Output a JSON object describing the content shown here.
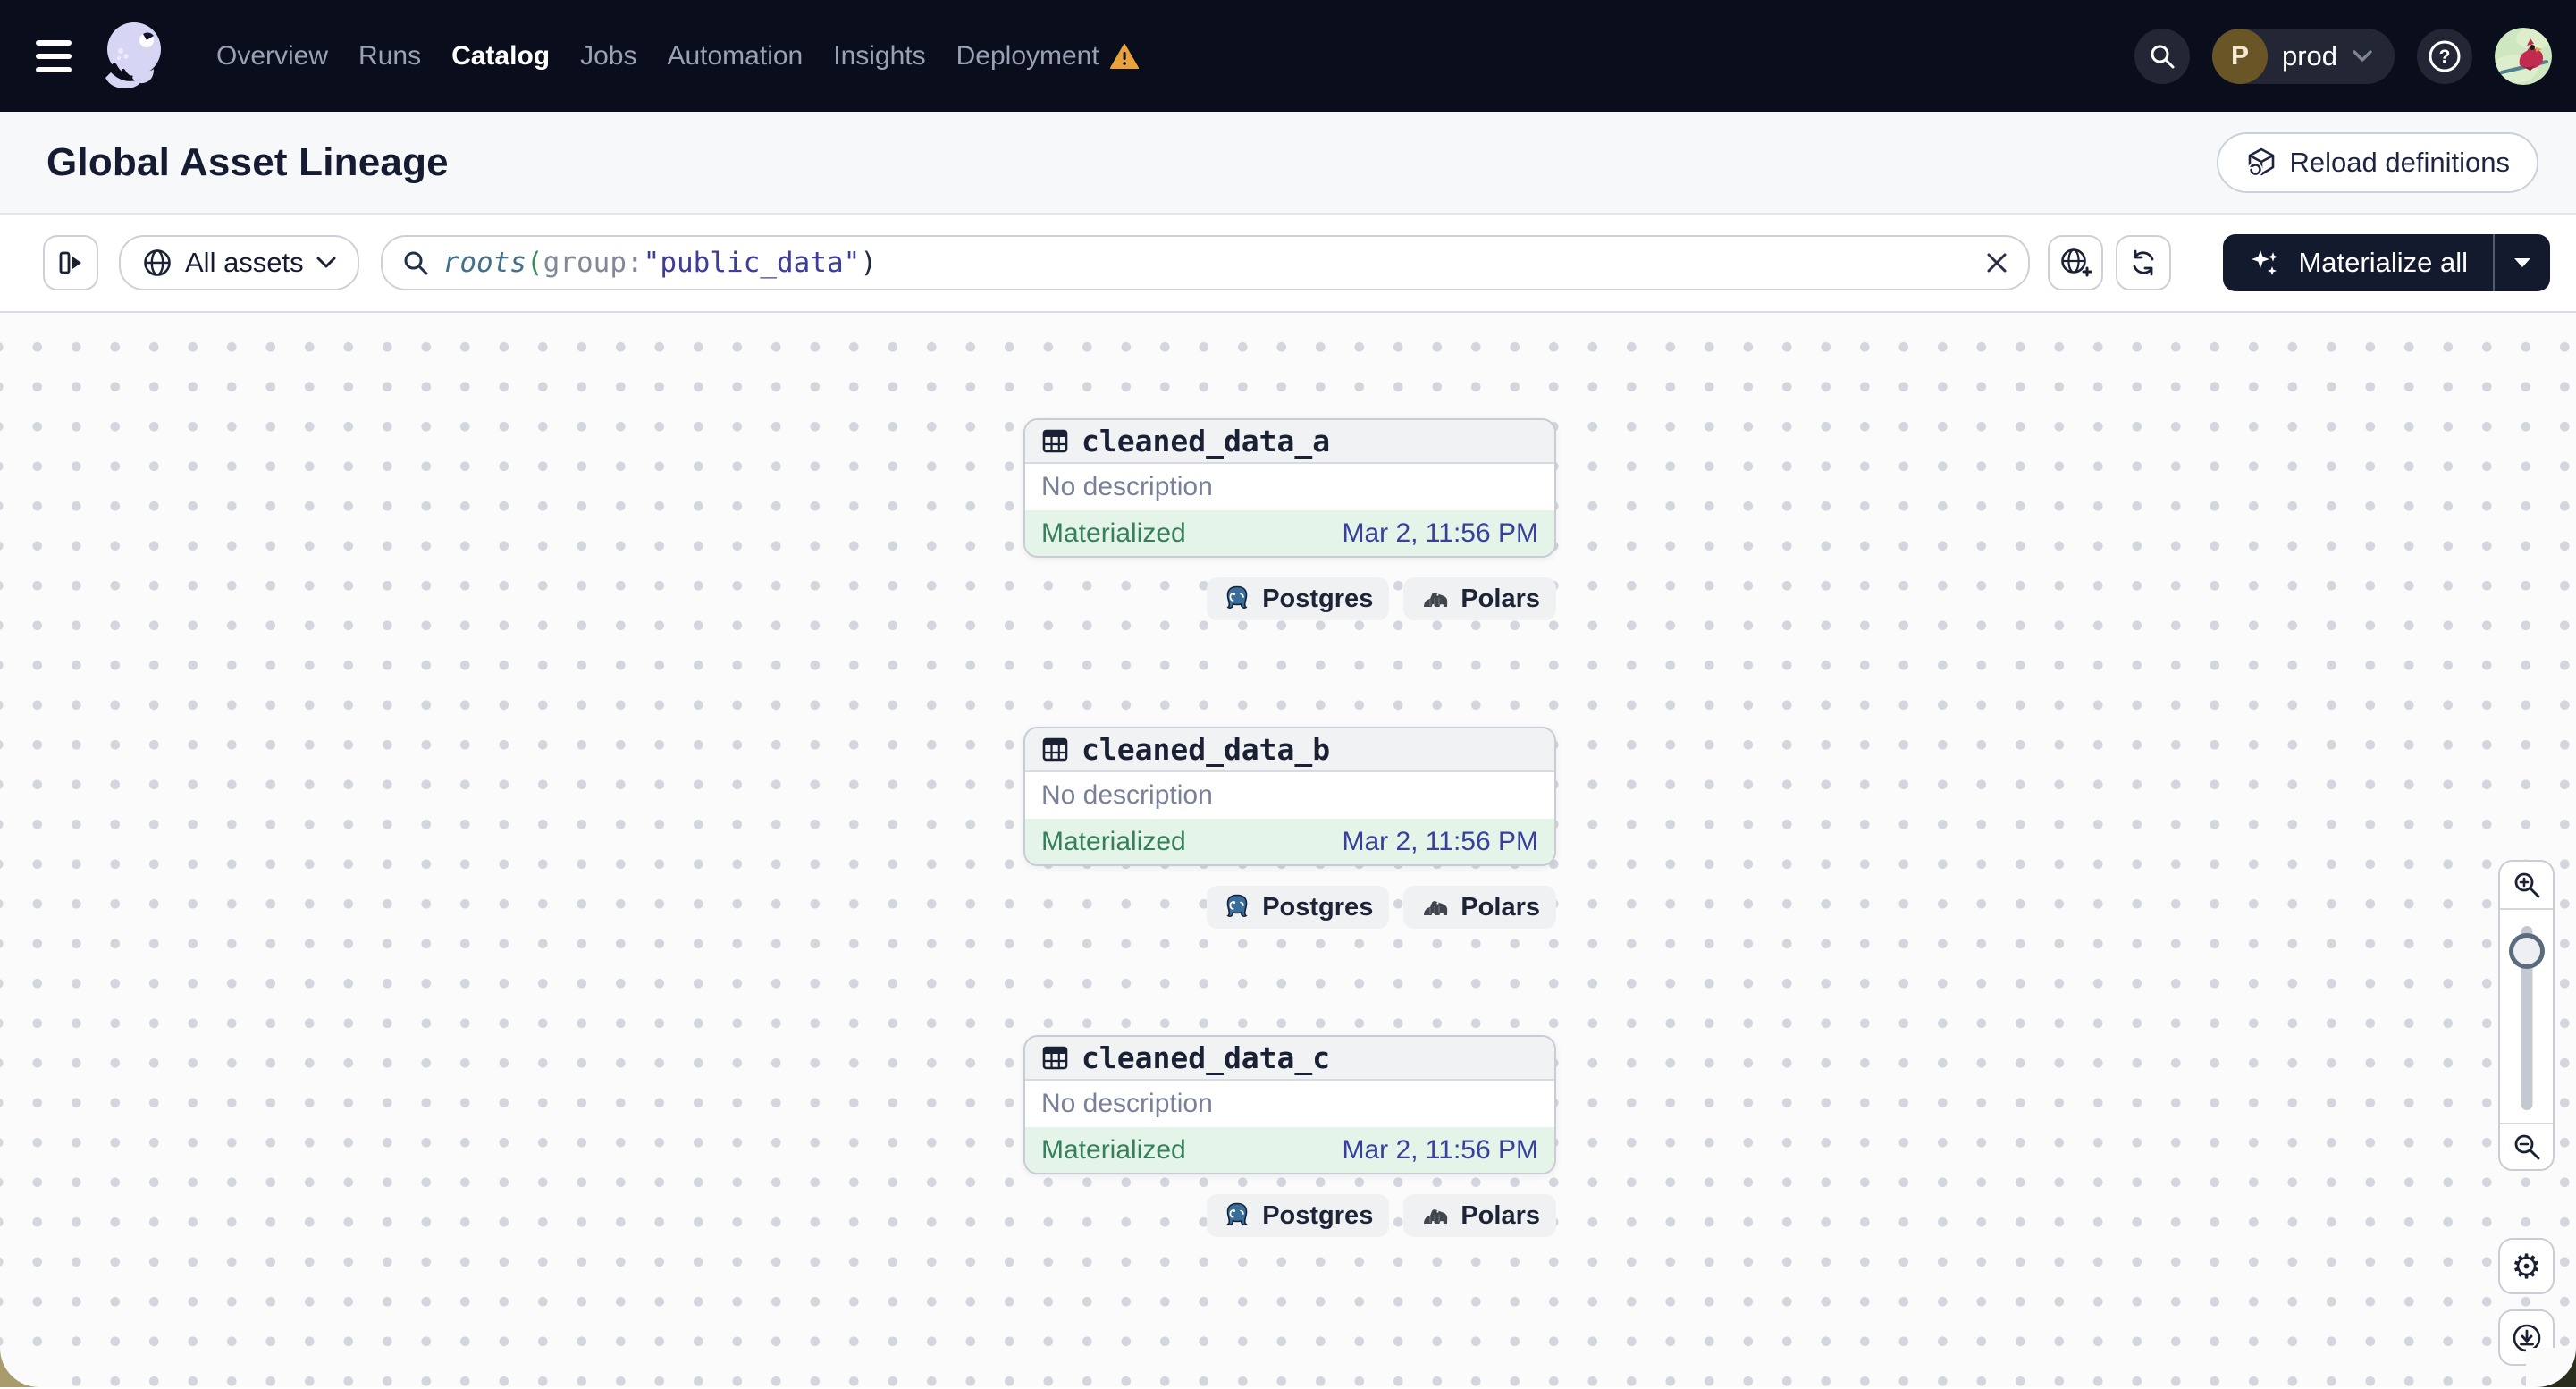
{
  "nav": {
    "items": [
      {
        "label": "Overview"
      },
      {
        "label": "Runs"
      },
      {
        "label": "Catalog",
        "active": true
      },
      {
        "label": "Jobs"
      },
      {
        "label": "Automation"
      },
      {
        "label": "Insights"
      },
      {
        "label": "Deployment",
        "warning": true
      }
    ],
    "environment": {
      "badge": "P",
      "name": "prod"
    }
  },
  "header": {
    "title": "Global Asset Lineage",
    "reload_label": "Reload definitions"
  },
  "toolbar": {
    "filter_label": "All assets",
    "query": {
      "fn": "roots",
      "open_paren": "(",
      "key": "group",
      "colon": ":",
      "value": "\"public_data\"",
      "close_paren": ")"
    },
    "materialize_label": "Materialize all"
  },
  "graph": {
    "nodes": [
      {
        "name": "cleaned_data_a",
        "description": "No description",
        "status": "Materialized",
        "timestamp": "Mar 2, 11:56 PM",
        "tags": [
          {
            "label": "Postgres",
            "icon": "postgres-icon"
          },
          {
            "label": "Polars",
            "icon": "polars-icon"
          }
        ]
      },
      {
        "name": "cleaned_data_b",
        "description": "No description",
        "status": "Materialized",
        "timestamp": "Mar 2, 11:56 PM",
        "tags": [
          {
            "label": "Postgres",
            "icon": "postgres-icon"
          },
          {
            "label": "Polars",
            "icon": "polars-icon"
          }
        ]
      },
      {
        "name": "cleaned_data_c",
        "description": "No description",
        "status": "Materialized",
        "timestamp": "Mar 2, 11:56 PM",
        "tags": [
          {
            "label": "Postgres",
            "icon": "postgres-icon"
          },
          {
            "label": "Polars",
            "icon": "polars-icon"
          }
        ]
      }
    ]
  },
  "colors": {
    "nav_bg": "#0a0d1b",
    "warning_orange": "#e9a13b",
    "status_green_bg": "#e4f4e9",
    "status_green_text": "#35805a",
    "timestamp_indigo": "#383f9c",
    "materialize_bg": "#141a2e",
    "query_fn": "#44708c",
    "query_value": "#3c3e99",
    "env_badge_bg": "#6a5527"
  }
}
